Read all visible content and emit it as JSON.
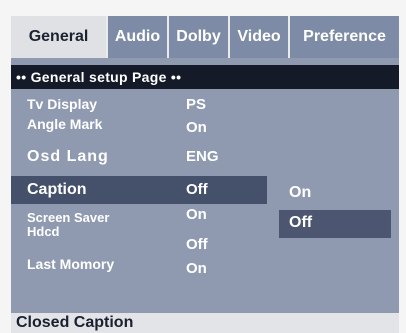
{
  "tabs": [
    {
      "label": "General",
      "active": true
    },
    {
      "label": "Audio",
      "active": false
    },
    {
      "label": "Dolby",
      "active": false
    },
    {
      "label": "Video",
      "active": false
    },
    {
      "label": "Preference",
      "active": false
    }
  ],
  "header": "•• General setup Page ••",
  "settings": [
    {
      "label": "Tv Display",
      "value": "PS"
    },
    {
      "label": "Angle Mark",
      "value": "On"
    },
    {
      "label": "Osd Lang",
      "value": "ENG"
    },
    {
      "label": "Caption",
      "value": "Off",
      "selected": true
    },
    {
      "label": "Screen Saver",
      "value": "On"
    },
    {
      "label": "Hdcd",
      "value": "Off"
    },
    {
      "label": "Last Momory",
      "value": "On"
    }
  ],
  "submenu": {
    "options": [
      "On",
      "Off"
    ],
    "highlighted": "Off"
  },
  "status_text": "Closed Caption",
  "colors": {
    "panel": "#8f9ab1",
    "header_bar": "#141a28",
    "tab_inactive": "#7d8ba7",
    "tab_active": "#dfe1e4",
    "highlight": "#45506a"
  }
}
